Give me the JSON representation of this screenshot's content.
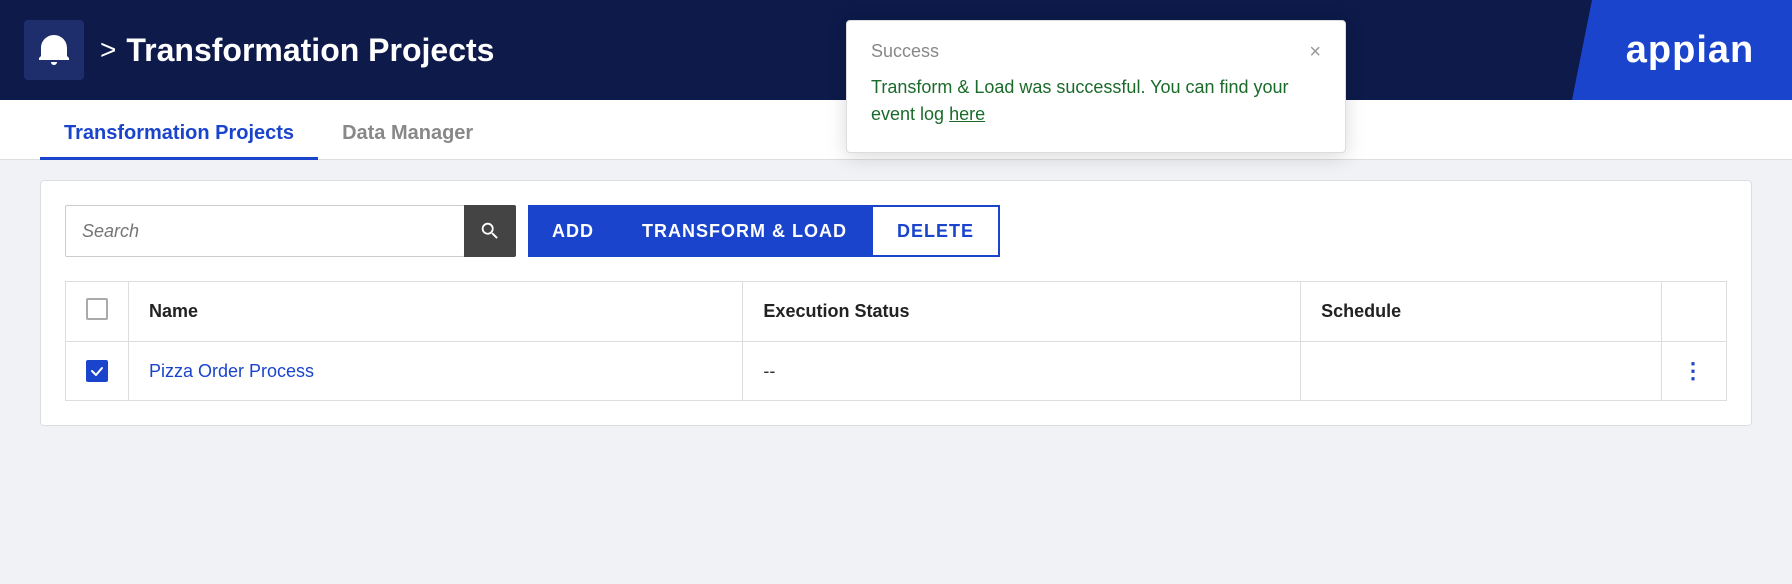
{
  "header": {
    "title": "Transformation Projects",
    "chevron": ">",
    "logo": "appian"
  },
  "tabs": [
    {
      "id": "transformation-projects",
      "label": "Transformation Projects",
      "active": true
    },
    {
      "id": "data-manager",
      "label": "Data Manager",
      "active": false
    }
  ],
  "toolbar": {
    "search_placeholder": "Search",
    "add_label": "ADD",
    "transform_label": "TRANSFORM & LOAD",
    "delete_label": "DELETE"
  },
  "table": {
    "columns": [
      {
        "id": "checkbox",
        "label": ""
      },
      {
        "id": "name",
        "label": "Name"
      },
      {
        "id": "execution_status",
        "label": "Execution Status"
      },
      {
        "id": "schedule",
        "label": "Schedule"
      },
      {
        "id": "actions",
        "label": ""
      }
    ],
    "rows": [
      {
        "id": "pizza-order-process",
        "name": "Pizza Order Process",
        "execution_status": "--",
        "schedule": "",
        "checked": true
      }
    ]
  },
  "notification": {
    "title": "Success",
    "message_part1": "Transform & Load was successful. You can find your event log ",
    "link_text": "here",
    "close_label": "×"
  },
  "colors": {
    "primary": "#1a44cc",
    "header_bg": "#0d1a4a",
    "success_text": "#1a6b2a"
  }
}
